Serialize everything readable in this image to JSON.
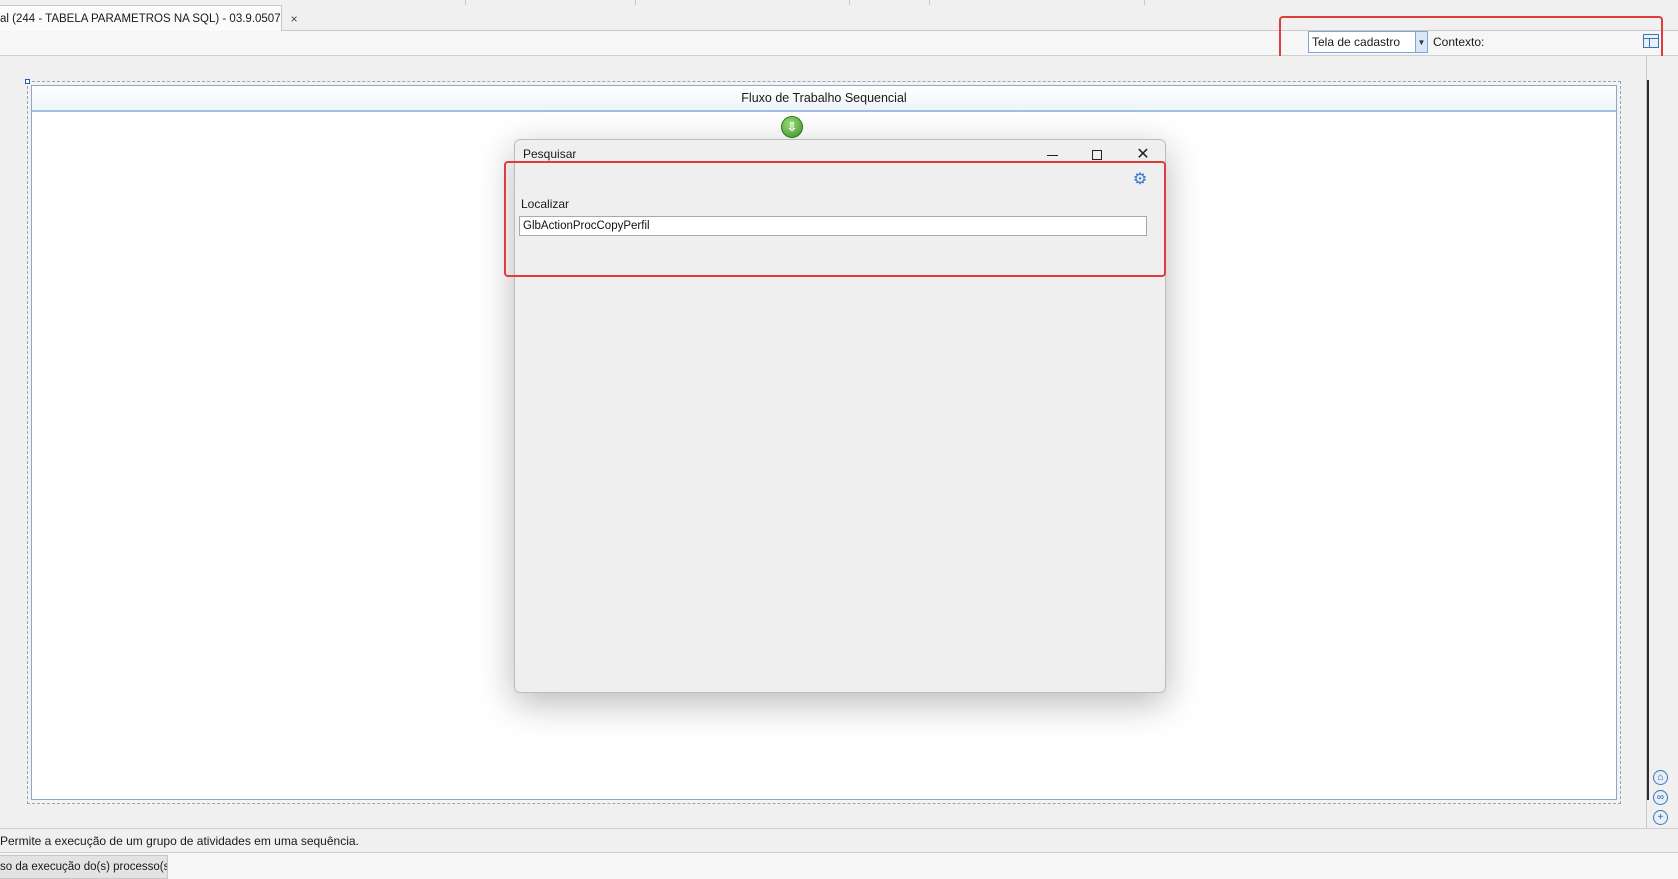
{
  "document_tab": {
    "label": "al (244 - TABELA PARAMETROS NA SQL) - 03.9.0507",
    "close": "×"
  },
  "toolbar": {
    "context_select_value": "Tela de cadastro",
    "context_label": "Contexto:"
  },
  "workflow": {
    "title": "Fluxo de Trabalho Sequencial"
  },
  "dialog": {
    "title": "Pesquisar",
    "find_label": "Localizar",
    "find_value": "GlbActionProcCopyPerfil"
  },
  "status": {
    "description": "Permite a execução de um grupo de atividades em uma sequência.",
    "bottom_tab": "so da execução do(s) processo(s)"
  },
  "colors": {
    "highlight": "#e03c3c",
    "start_node": "#3f9a2a",
    "accent": "#2f78c4"
  }
}
